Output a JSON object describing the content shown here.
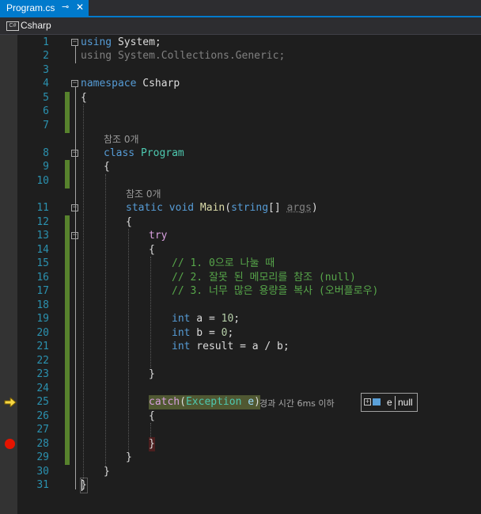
{
  "tab": {
    "title": "Program.cs",
    "pin_glyph": "⊸",
    "close_glyph": "✕"
  },
  "nav": {
    "project_icon": "C#",
    "project": "Csharp"
  },
  "line_numbers": [
    "1",
    "2",
    "3",
    "4",
    "5",
    "6",
    "7",
    "8",
    "9",
    "10",
    "11",
    "12",
    "13",
    "14",
    "15",
    "16",
    "17",
    "18",
    "19",
    "20",
    "21",
    "22",
    "23",
    "24",
    "25",
    "26",
    "27",
    "28",
    "29",
    "30",
    "31"
  ],
  "code": {
    "l1_kw": "using",
    "l1_rest": " System;",
    "l2_kw": "using",
    "l2_rest": " System.Collections.Generic;",
    "l4_kw": "namespace",
    "l4_rest": " Csharp",
    "l5": "{",
    "ref1": "참조 0개",
    "l8_kw": "class",
    "l8_ty": " Program",
    "l9": "{",
    "ref2": "참조 0개",
    "l11_kw1": "static",
    "l11_kw2": " void",
    "l11_fn": " Main",
    "l11_p1": "(",
    "l11_kw3": "string",
    "l11_p2": "[] ",
    "l11_pm": "args",
    "l11_p3": ")",
    "l12": "{",
    "l13_kw": "try",
    "l14": "{",
    "l15": "// 1. 0으로 나눌 때",
    "l16": "// 2. 잘못 된 메모리를 참조 (null)",
    "l17": "// 3. 너무 많은 용량을 복사 (오버플로우)",
    "l19_kw": "int",
    "l19_a": " a = ",
    "l19_n": "10",
    "l19_b": ";",
    "l20_kw": "int",
    "l20_a": " b = ",
    "l20_n": "0",
    "l20_b": ";",
    "l21_kw": "int",
    "l21_a": " result = a / b;",
    "l23": "}",
    "l25_kw": "catch",
    "l25_p1": "(",
    "l25_ty": "Exception",
    "l25_pm": " e",
    "l25_p2": ")",
    "l26": "{",
    "l28": "}",
    "l29": "}",
    "l30": "}",
    "l31": "}"
  },
  "perf_tip": "경과 시간 6ms 이하",
  "datatip": {
    "expand": "+",
    "name": "e",
    "value": "null"
  },
  "colors": {
    "accent": "#007acc",
    "breakpoint": "#e51400",
    "change_bar": "#57822d"
  }
}
